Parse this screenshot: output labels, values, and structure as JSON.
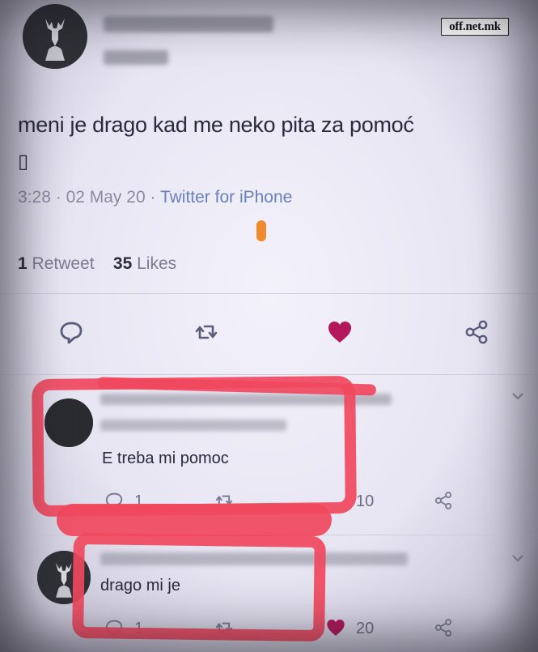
{
  "watermark": "off.net.mk",
  "tweet": {
    "text": "meni je drago kad me neko pita za pomoć",
    "emoji_placeholder": "▯",
    "time": "3:28",
    "date": "02 May 20",
    "source": "Twitter for iPhone",
    "retweets_count": "1",
    "retweets_label": "Retweet",
    "likes_count": "35",
    "likes_label": "Likes",
    "liked": true
  },
  "actions": [
    "reply-icon",
    "retweet-icon",
    "heart-icon",
    "share-icon"
  ],
  "replies": [
    {
      "text": "E treba mi pomoc",
      "reply_count": "1",
      "like_count": "10"
    },
    {
      "text": "drago mi je",
      "reply_count": "1",
      "like_count": "20"
    }
  ],
  "colors": {
    "highlight": "#f0485e",
    "like": "#c2185b",
    "accent": "#6a7fbf"
  }
}
